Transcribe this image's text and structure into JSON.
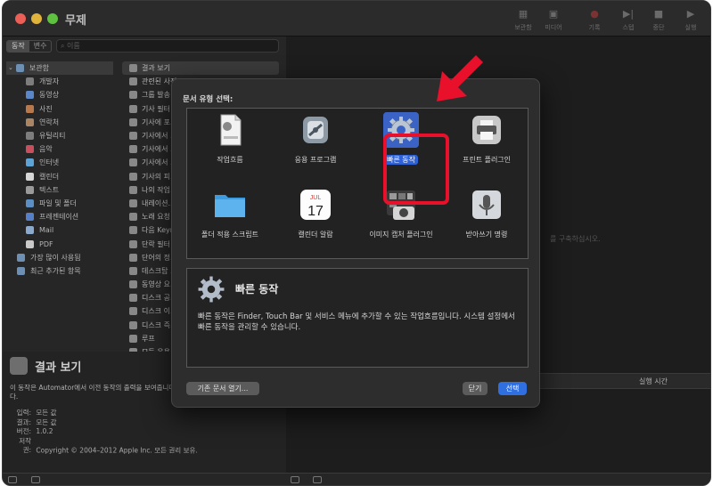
{
  "window": {
    "title": "무제"
  },
  "toolbar": [
    {
      "label": "보관함",
      "icon": "library-icon"
    },
    {
      "label": "미디어",
      "icon": "media-icon"
    },
    {
      "label": "기록",
      "icon": "record-icon"
    },
    {
      "label": "스텝",
      "icon": "step-icon"
    },
    {
      "label": "중단",
      "icon": "stop-icon"
    },
    {
      "label": "실행",
      "icon": "run-icon"
    }
  ],
  "library": {
    "tabs": [
      "동작",
      "변수"
    ],
    "search_placeholder": "이름",
    "categories": [
      "보관함",
      "개발자",
      "동영상",
      "사진",
      "연락처",
      "유틸리티",
      "음악",
      "인터넷",
      "캘린더",
      "텍스트",
      "파일 및 폴더",
      "프레젠테이션",
      "Mail",
      "PDF",
      "가장 많이 사용됨",
      "최근 추가된 항목"
    ],
    "actions": [
      "결과 보기",
      "관련된 사진 ...",
      "그룹 발송",
      "기사 필터",
      "기사에 포...",
      "기사에서 ...",
      "기사에서 ...",
      "기사에서 ...",
      "기사의 피...",
      "나의 작업...",
      "내레이션...",
      "노래 요청",
      "다음 Keyn...",
      "단락 필터",
      "단어의 정...",
      "데스크탑 ...",
      "동영상 요...",
      "디스크 공...",
      "디스크 이...",
      "디스크 즉...",
      "루프",
      "모든 응용..."
    ]
  },
  "description": {
    "title": "결과 보기",
    "text": "이 동작은 Automator에서 이전 동작의 출력을 보여줍니다. 데스크하고 해결하는 데 유용합니다.",
    "meta": [
      {
        "key": "입력:",
        "value": "모든 값"
      },
      {
        "key": "결과:",
        "value": "모든 값"
      },
      {
        "key": "버전:",
        "value": "1.0.2"
      },
      {
        "key": "저작권:",
        "value": "Copyright © 2004–2012 Apple Inc. 모든 권리 보유."
      }
    ]
  },
  "workflow": {
    "hint": "를 구축하십시오.",
    "log_column": "실행 시간"
  },
  "dialog": {
    "title": "문서 유형 선택:",
    "types": [
      {
        "label": "작업흐름",
        "icon": "workflow-document-icon"
      },
      {
        "label": "응용 프로그램",
        "icon": "automator-app-icon"
      },
      {
        "label": "빠른 동작",
        "icon": "gear-icon"
      },
      {
        "label": "프린트 플러그인",
        "icon": "printer-icon"
      },
      {
        "label": "폴더 적용 스크립트",
        "icon": "folder-icon"
      },
      {
        "label": "캘린더 알람",
        "icon": "calendar-icon"
      },
      {
        "label": "이미지 캡처 플러그인",
        "icon": "camera-icon"
      },
      {
        "label": "받아쓰기 명령",
        "icon": "microphone-icon"
      }
    ],
    "calendar": {
      "month": "JUL",
      "day": "17"
    },
    "selected": {
      "title": "빠른 동작",
      "text": "빠른 동작은 Finder, Touch Bar 및 서비스 메뉴에 추가할 수 있는 작업흐름입니다. 시스템 설정에서 빠른 동작을 관리할 수 있습니다."
    },
    "buttons": {
      "open_existing": "기존 문서 열기...",
      "close": "닫기",
      "choose": "선택"
    }
  },
  "colors": {
    "accent": "#2f62d8",
    "highlight": "#e8102b"
  }
}
